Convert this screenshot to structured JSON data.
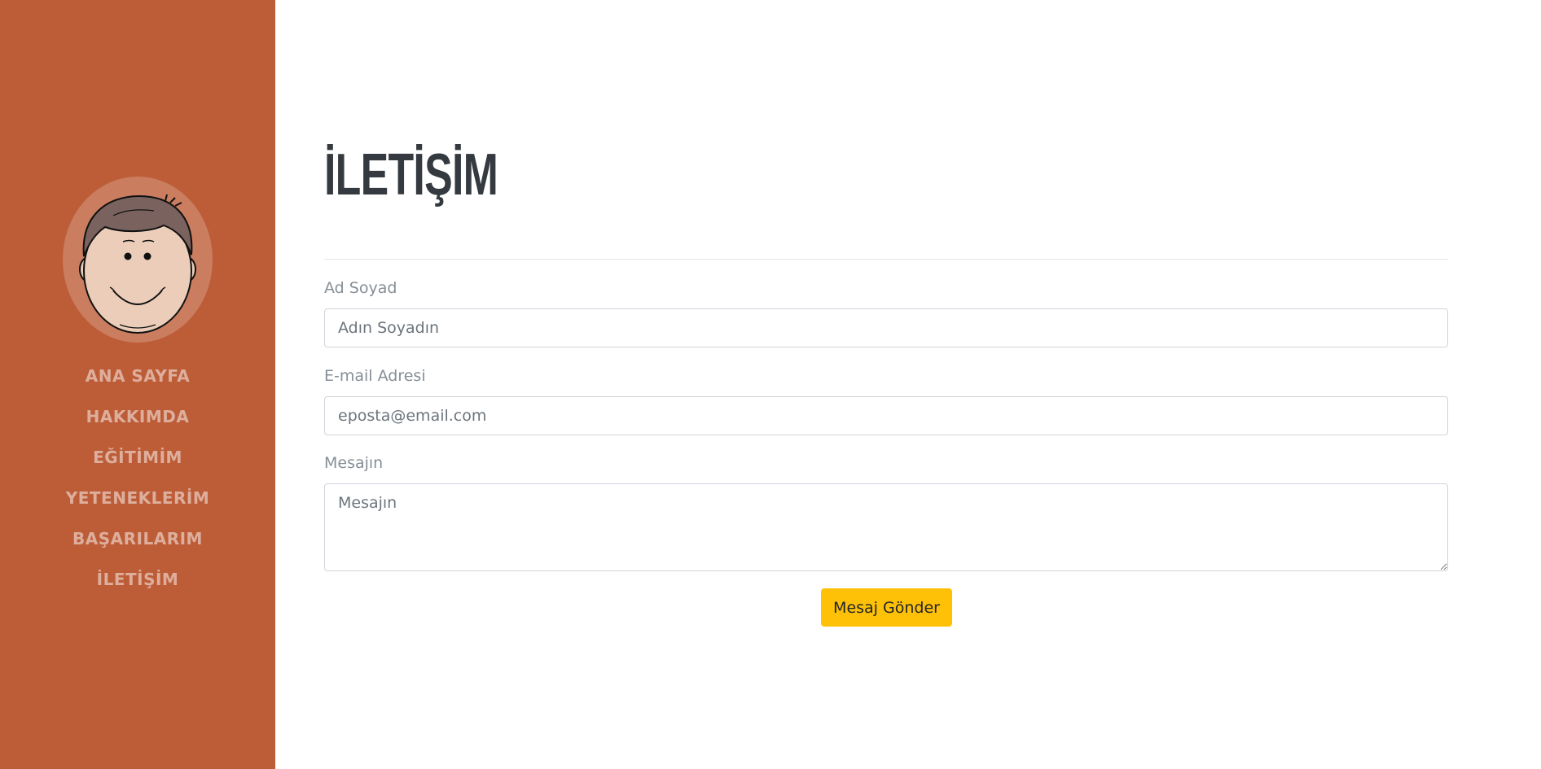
{
  "sidebar": {
    "avatar_icon": "cartoon-boy-face",
    "items": [
      {
        "label": "ANA SAYFA"
      },
      {
        "label": "HAKKIMDA"
      },
      {
        "label": "EĞİTİMİM"
      },
      {
        "label": "YETENEKLERİM"
      },
      {
        "label": "BAŞARILARIM"
      },
      {
        "label": "İLETİŞİM"
      }
    ]
  },
  "main": {
    "title": "İLETİŞİM",
    "form": {
      "name_label": "Ad Soyad",
      "name_placeholder": "Adın Soyadın",
      "email_label": "E-mail Adresi",
      "email_placeholder": "eposta@email.com",
      "message_label": "Mesajın",
      "message_placeholder": "Mesajın",
      "submit_label": "Mesaj Gönder"
    }
  },
  "colors": {
    "sidebar_bg": "#bd5d38",
    "button_bg": "#ffc107",
    "title": "#343a40"
  }
}
